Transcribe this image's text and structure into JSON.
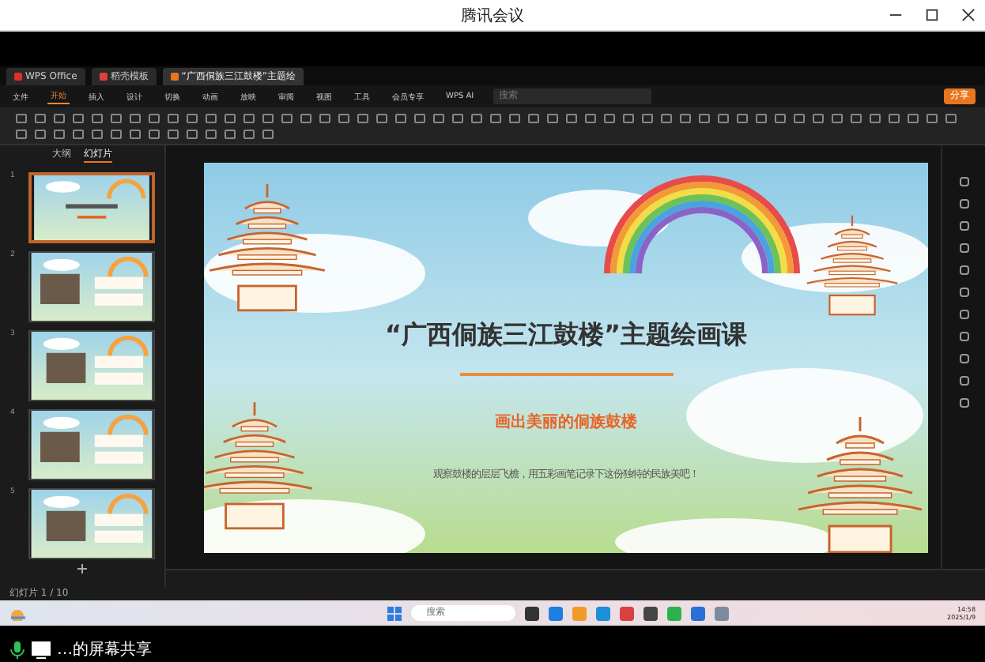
{
  "window": {
    "title": "腾讯会议"
  },
  "wps": {
    "tabs": [
      {
        "label": "WPS Office",
        "selected": false
      },
      {
        "label": "稻壳模板",
        "selected": false
      },
      {
        "label": "“广西侗族三江鼓楼”主题绘",
        "selected": true
      }
    ],
    "file_menu": "文件",
    "ribbon_tabs": [
      {
        "label": "开始",
        "selected": true
      },
      {
        "label": "插入",
        "selected": false
      },
      {
        "label": "设计",
        "selected": false
      },
      {
        "label": "切换",
        "selected": false
      },
      {
        "label": "动画",
        "selected": false
      },
      {
        "label": "放映",
        "selected": false
      },
      {
        "label": "审阅",
        "selected": false
      },
      {
        "label": "视图",
        "selected": false
      },
      {
        "label": "工具",
        "selected": false
      },
      {
        "label": "会员专享",
        "selected": false
      }
    ],
    "ai_label": "WPS AI",
    "search": {
      "placeholder": "搜索"
    },
    "share_button": "分享",
    "panel_tabs": [
      {
        "label": "大纲",
        "selected": false
      },
      {
        "label": "幻灯片",
        "selected": true
      }
    ],
    "thumbnails": [
      {
        "number": "1",
        "selected": true
      },
      {
        "number": "2",
        "selected": false
      },
      {
        "number": "3",
        "selected": false
      },
      {
        "number": "4",
        "selected": false
      },
      {
        "number": "5",
        "selected": false
      }
    ],
    "slide": {
      "title": "“广西侗族三江鼓楼”主题绘画课",
      "subtitle": "画出美丽的侗族鼓楼",
      "caption": "观察鼓楼的层层飞檐，用五彩画笔记录下这份独特的民族美吧！"
    },
    "status_bar": {
      "slide_count": "幻灯片 1 / 10"
    }
  },
  "taskbar": {
    "search": {
      "placeholder": "搜索"
    },
    "time": "14:58",
    "date": "2025/1/9"
  },
  "sharing_label": "…的屏幕共享"
}
